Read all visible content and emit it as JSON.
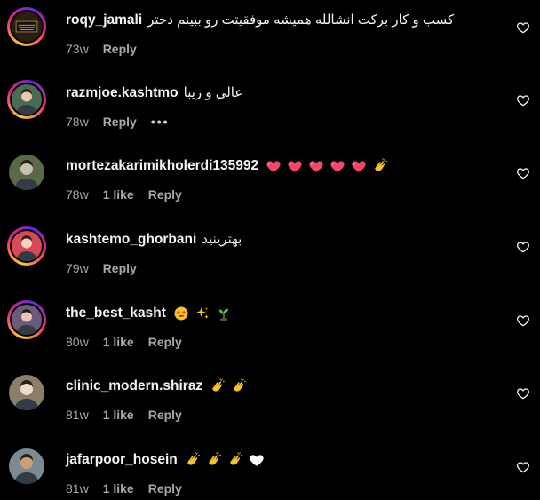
{
  "comments": [
    {
      "username": "roqy_jamali",
      "text": "کسب و کار برکت انشالله همیشه موفقیتت رو ببینم دختر",
      "emojis": [],
      "time": "73w",
      "likes": "",
      "reply": "Reply",
      "more": "",
      "avatar": {
        "ring": true,
        "bg": "#2a1e12",
        "fg": "#c9a463",
        "icon": "logo-avatar"
      }
    },
    {
      "username": "razmjoe.kashtmo",
      "text": "عالی و زیبا",
      "emojis": [],
      "time": "78w",
      "likes": "",
      "reply": "Reply",
      "more": "•••",
      "avatar": {
        "ring": true,
        "bg": "#4a6b54",
        "fg": "#e8c9b0",
        "icon": "person-avatar"
      }
    },
    {
      "username": "mortezakarimikholerdi135992",
      "text": "",
      "emojis": [
        "heart-icon",
        "heart-icon",
        "heart-icon",
        "heart-icon",
        "heart-icon",
        "clap-icon"
      ],
      "time": "78w",
      "likes": "1 like",
      "reply": "Reply",
      "more": "",
      "avatar": {
        "ring": false,
        "bg": "#5a6a48",
        "fg": "#c7c2b0",
        "icon": "person-avatar"
      }
    },
    {
      "username": "kashtemo_ghorbani",
      "text": "بهترینید",
      "emojis": [],
      "time": "79w",
      "likes": "",
      "reply": "Reply",
      "more": "",
      "avatar": {
        "ring": true,
        "bg": "#d94a58",
        "fg": "#f3d2c4",
        "icon": "person-avatar"
      }
    },
    {
      "username": "the_best_kasht",
      "text": "",
      "emojis": [
        "star-struck-icon",
        "sparkles-icon",
        "seedling-icon"
      ],
      "time": "80w",
      "likes": "1 like",
      "reply": "Reply",
      "more": "",
      "avatar": {
        "ring": true,
        "bg": "#6b5a7a",
        "fg": "#e6c7b6",
        "icon": "person-avatar"
      }
    },
    {
      "username": "clinic_modern.shiraz",
      "text": "",
      "emojis": [
        "clap-icon",
        "clap-icon"
      ],
      "time": "81w",
      "likes": "1 like",
      "reply": "Reply",
      "more": "",
      "avatar": {
        "ring": false,
        "bg": "#8a7d6c",
        "fg": "#eddcc8",
        "icon": "person-avatar"
      }
    },
    {
      "username": "jafarpoor_hosein",
      "text": "",
      "emojis": [
        "clap-icon",
        "clap-icon",
        "clap-icon",
        "white-heart-icon"
      ],
      "time": "81w",
      "likes": "1 like",
      "reply": "Reply",
      "more": "",
      "avatar": {
        "ring": false,
        "bg": "#7c8a94",
        "fg": "#c9a07c",
        "icon": "person-avatar"
      }
    }
  ],
  "colors": {
    "background": "#000000",
    "primary_text": "#f5f5f5",
    "secondary_text": "#a8a8a8",
    "heart_emoji": "#f0476d",
    "clap_emoji": "#f7c12c"
  }
}
